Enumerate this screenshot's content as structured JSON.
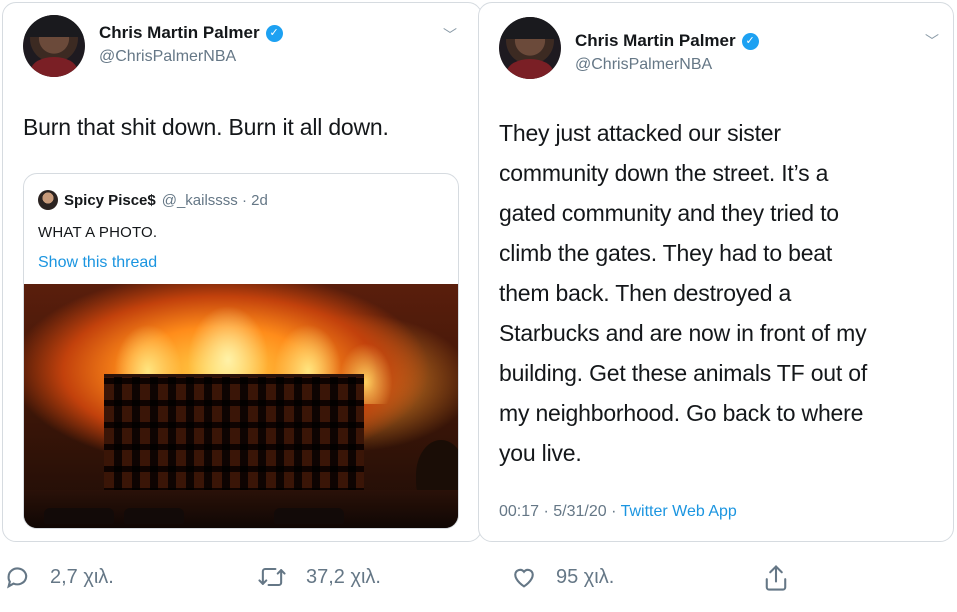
{
  "left_tweet": {
    "author_name": "Chris Martin Palmer",
    "author_handle": "@ChrisPalmerNBA",
    "text": "Burn that shit down. Burn it all down.",
    "quote": {
      "name": "Spicy Pisce$",
      "handle_time": "@_kailssss · 2d",
      "text": "WHAT A PHOTO.",
      "link": "Show this thread",
      "image": "burning-building-photo"
    }
  },
  "right_tweet": {
    "author_name": "Chris Martin Palmer",
    "author_handle": "@ChrisPalmerNBA",
    "text_lines": [
      "They just attacked our sister",
      "community down the street. It’s a",
      "gated community and they tried to",
      "climb the gates. They had to beat",
      "them back. Then destroyed a",
      "Starbucks and are now in front of my",
      "building. Get these animals TF out of",
      "my neighborhood. Go back to where",
      "you live."
    ],
    "timestamp": "00:17 · 5/31/20 · ",
    "source": "Twitter Web App"
  },
  "actions": {
    "reply_count": "2,7 χιλ.",
    "retweet_count": "37,2 χιλ.",
    "like_count": "95 χιλ.",
    "icons": [
      "reply-icon",
      "retweet-icon",
      "like-icon",
      "share-icon"
    ]
  },
  "colors": {
    "accent": "#1b95e0",
    "verified": "#1da1f2",
    "muted": "#657786"
  }
}
